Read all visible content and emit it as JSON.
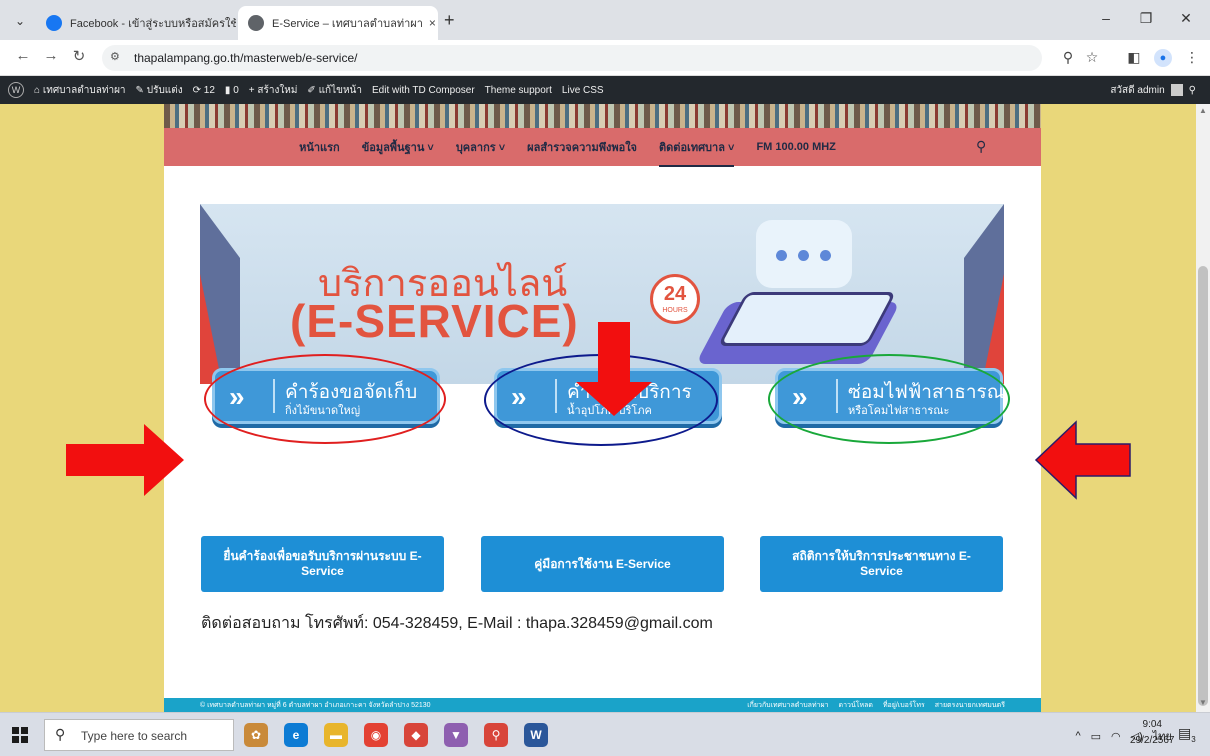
{
  "browser": {
    "tabs": [
      {
        "title": "Facebook - เข้าสู่ระบบหรือสมัครใช้ง",
        "favicon": "facebook-icon",
        "color": "#1877f2",
        "active": false
      },
      {
        "title": "E-Service – เทศบาลตำบลท่าผา",
        "favicon": "globe-icon",
        "color": "#5f6368",
        "active": true
      }
    ],
    "close_glyph": "×",
    "new_tab_glyph": "+",
    "menu_glyph": "⌄",
    "url": "thapalampang.go.th/masterweb/e-service/",
    "window_controls": {
      "minimize": "–",
      "restore": "❐",
      "close": "✕"
    }
  },
  "wpbar": {
    "site": "เทศบาลตำบลท่าผา",
    "customize": "ปรับแต่ง",
    "updates": "12",
    "comments": "0",
    "new": "สร้างใหม่",
    "edit": "แก้ไขหน้า",
    "td_composer": "Edit with TD Composer",
    "theme_support": "Theme support",
    "live_css": "Live CSS",
    "greeting": "สวัสดี admin"
  },
  "nav": {
    "items": [
      {
        "label": "หน้าแรก",
        "active": false
      },
      {
        "label": "ข้อมูลพื้นฐาน ˅",
        "active": false
      },
      {
        "label": "บุคลากร ˅",
        "active": false
      },
      {
        "label": "ผลสำรวจความพึงพอใจ",
        "active": false
      },
      {
        "label": "ติดต่อเทศบาล ˅",
        "active": true
      },
      {
        "label": "FM 100.00 MHZ",
        "active": false
      }
    ]
  },
  "banner": {
    "title": "บริการออนไลน์",
    "subtitle": "(E-SERVICE)",
    "badge_number": "24",
    "badge_label": "HOURS"
  },
  "services": [
    {
      "line1": "คำร้องขอจัดเก็บ",
      "line2": "กิ่งไม้ขนาดใหญ่",
      "ring_color": "#e01f1f"
    },
    {
      "line1": "คำขอรับบริการ",
      "line2": "น้ำอุปโภค-บริโภค",
      "ring_color": "#0d1a8c"
    },
    {
      "line1": "ซ่อมไฟฟ้าสาธารณะ",
      "line2": "หรือโคมไฟสาธารณะ",
      "ring_color": "#19a83a"
    }
  ],
  "chevron_glyph": "»",
  "lower_buttons": [
    "ยื่นคำร้องเพื่อขอรับบริการผ่านระบบ E-Service",
    "คู่มือการใช้งาน E-Service",
    "สถิติการให้บริการประชาชนทาง E-Service"
  ],
  "contact": "ติดต่อสอบถาม โทรศัพท์: 054-328459, E-Mail : thapa.328459@gmail.com",
  "footer": {
    "copyright": "© เทศบาลตำบลท่าผา หมู่ที่ 6 ตำบลท่าผา อำเภอเกาะคา จังหวัดลำปาง 52130",
    "links": [
      "เกี่ยวกับเทศบาลตำบลท่าผา",
      "ดาวน์โหลด",
      "ที่อยู่/เบอร์โทร",
      "สายตรงนายกเทศมนตรี"
    ]
  },
  "arrow_color": "#f20f0f",
  "taskbar": {
    "search_placeholder": "Type here to search",
    "apps": [
      {
        "name": "photos-app-icon",
        "color": "#c98a3a",
        "glyph": "✿"
      },
      {
        "name": "edge-icon",
        "color": "#0c7bd4",
        "glyph": "e"
      },
      {
        "name": "file-explorer-icon",
        "color": "#e8b52c",
        "glyph": "▬"
      },
      {
        "name": "chrome-icon",
        "color": "#e34133",
        "glyph": "◉"
      },
      {
        "name": "app-icon",
        "color": "#d8453a",
        "glyph": "◆"
      },
      {
        "name": "paint-icon",
        "color": "#8e5fb0",
        "glyph": "▼"
      },
      {
        "name": "search-app-icon",
        "color": "#d8453a",
        "glyph": "⚲"
      },
      {
        "name": "word-icon",
        "color": "#2b579a",
        "glyph": "W"
      }
    ],
    "language": "ไทย",
    "time": "9:04",
    "date": "29/2/2567",
    "notification_count": "3"
  }
}
